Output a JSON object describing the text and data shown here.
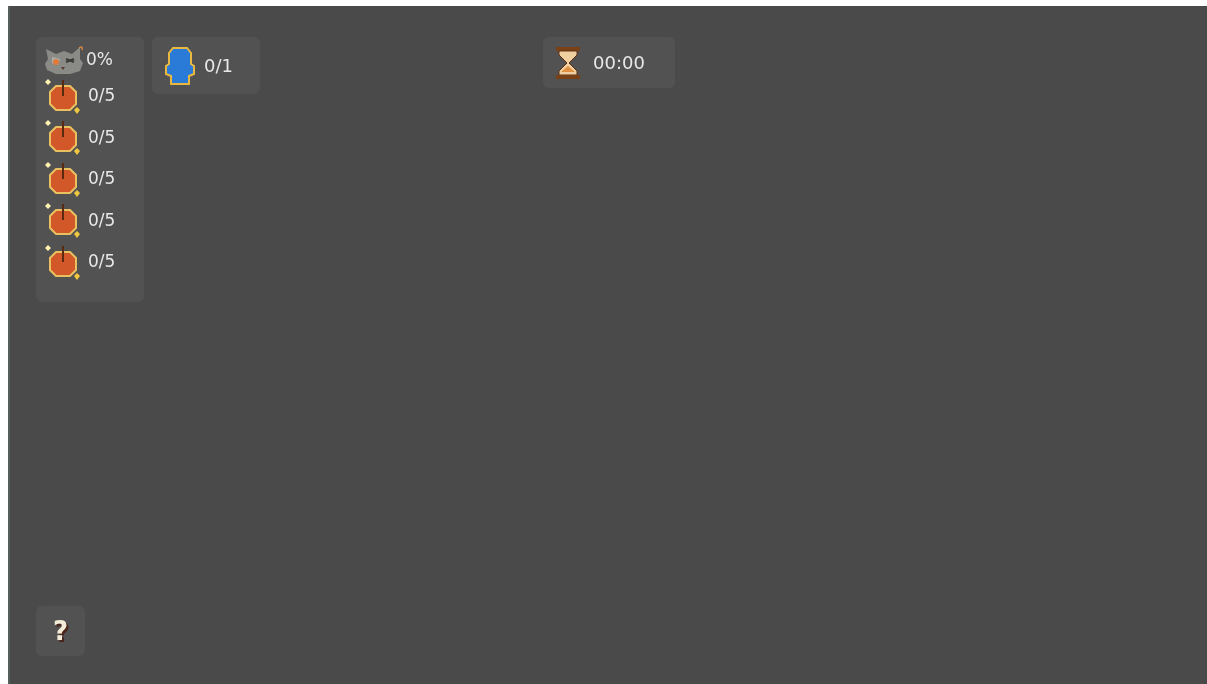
{
  "stats": {
    "completion": "0%",
    "collectibles": [
      {
        "count": "0/5"
      },
      {
        "count": "0/5"
      },
      {
        "count": "0/5"
      },
      {
        "count": "0/5"
      },
      {
        "count": "0/5"
      }
    ]
  },
  "players": {
    "count": "0/1"
  },
  "timer": {
    "time": "00:00"
  },
  "help_button": {
    "label": "?"
  }
}
